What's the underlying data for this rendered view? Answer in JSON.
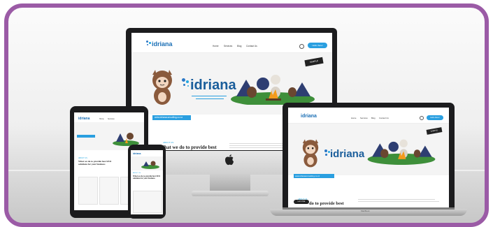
{
  "site": {
    "logo": "idriana",
    "nav": [
      "Home",
      "Services",
      "Blog",
      "Contact Us"
    ],
    "cta": "Hello there!",
    "hero_title": "idriana",
    "url_banner": "www.idrianaconsulting.co.nz",
    "section_heading": "What we do to provide best",
    "section_heading_short": "do to provide best",
    "about_label": "ABOUT US",
    "mobile_heading": "What we do to provide best SEO solutions for your business",
    "stamp": "SAMPLE"
  },
  "devices": {
    "laptop_brand": "MacBook",
    "laptop_button": "Let's Chat"
  },
  "colors": {
    "frame": "#9b5ba6",
    "accent": "#2a9fe0",
    "logo": "#1b6fb5"
  }
}
